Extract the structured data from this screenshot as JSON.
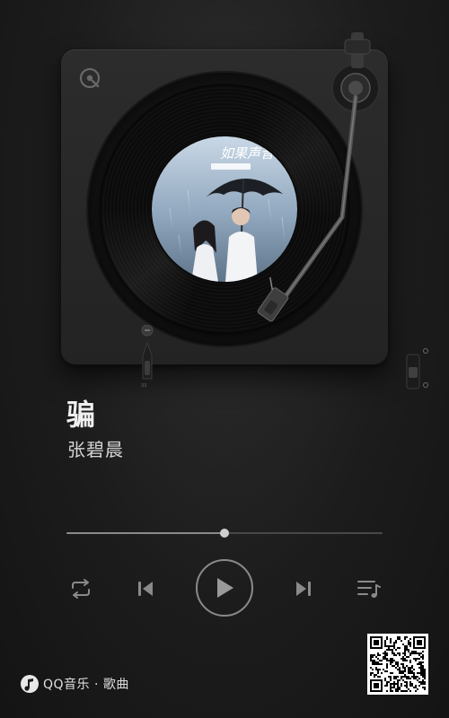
{
  "song": {
    "title": "骗",
    "artist": "张碧晨"
  },
  "album_art": {
    "cover_text": "如果声音不记得",
    "description": "two people under a black umbrella in the rain"
  },
  "playback": {
    "progress_fraction": 0.5,
    "state": "paused"
  },
  "controls": {
    "repeat": "repeat-icon",
    "previous": "skip-previous-icon",
    "play": "play-icon",
    "next": "skip-next-icon",
    "playlist": "playlist-icon"
  },
  "footer": {
    "brand_label": "QQ音乐 · 歌曲"
  },
  "colors": {
    "background": "#1c1c1c",
    "turntable": "#282828",
    "text_primary": "#f0f0f0",
    "controls": "#8a8a8a"
  }
}
